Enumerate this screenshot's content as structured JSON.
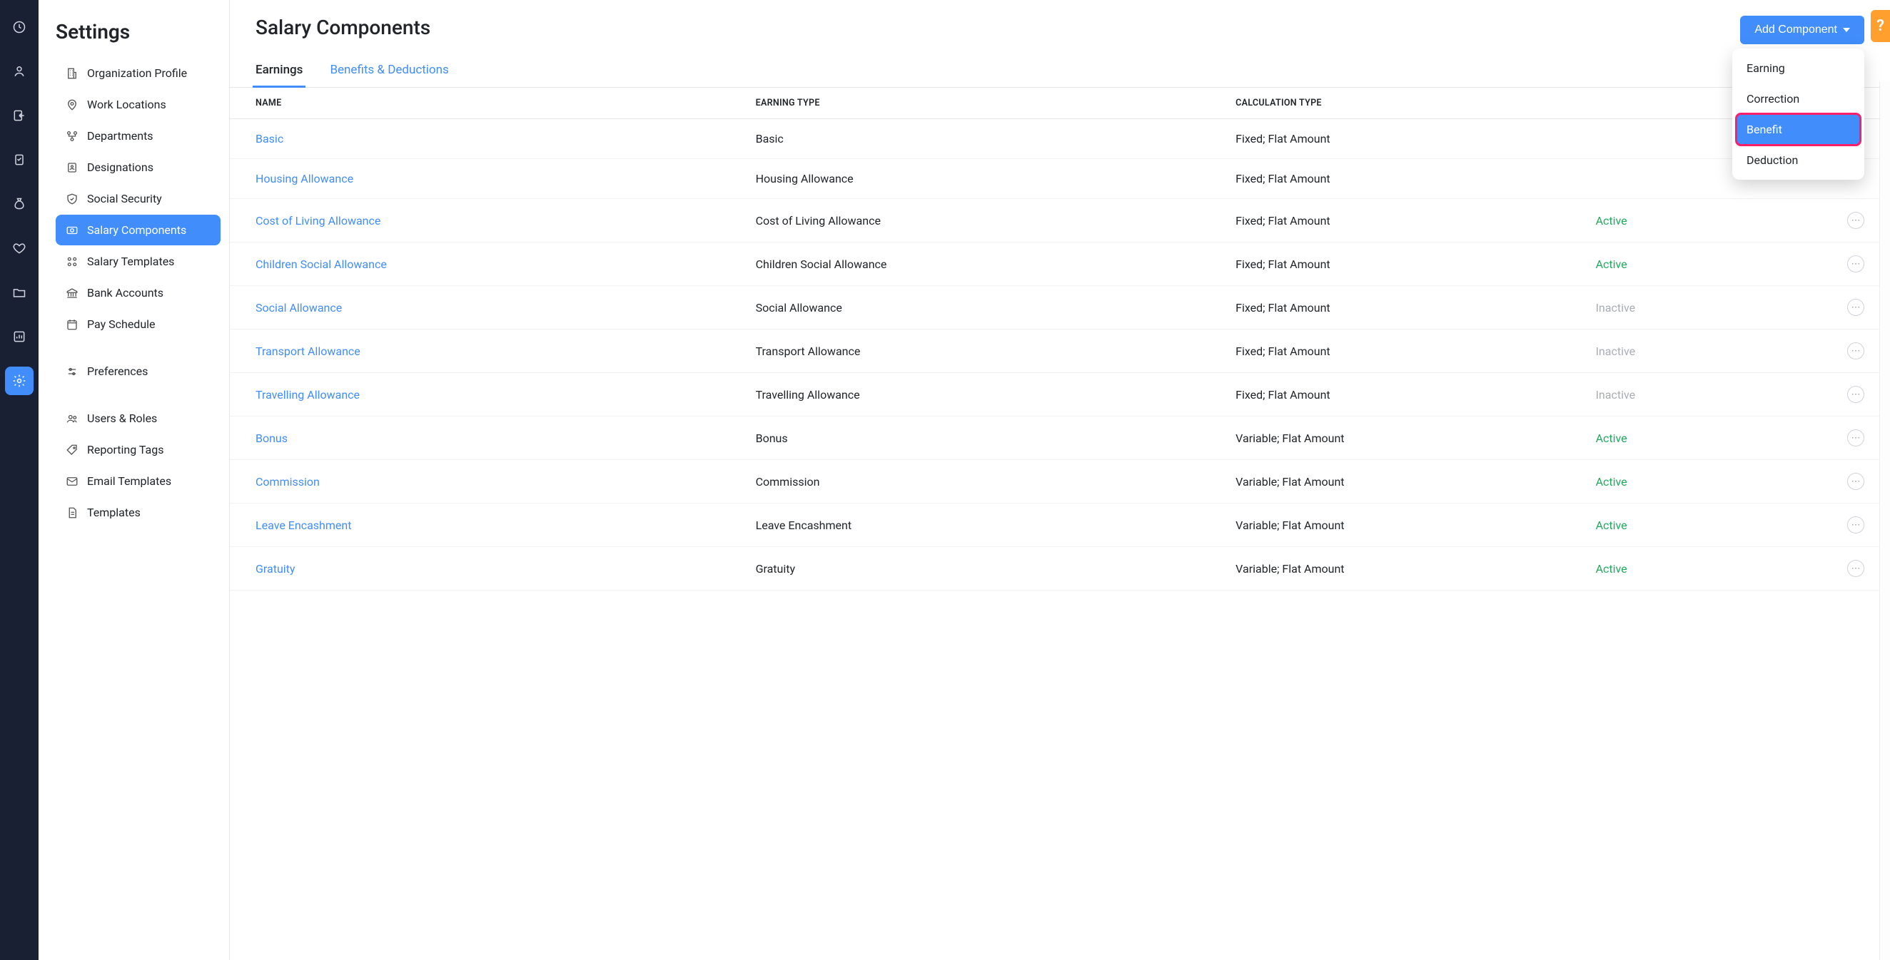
{
  "rail": [
    {
      "name": "dashboard-icon"
    },
    {
      "name": "person-icon"
    },
    {
      "name": "exit-icon"
    },
    {
      "name": "clipboard-icon"
    },
    {
      "name": "money-bag-icon"
    },
    {
      "name": "heart-icon"
    },
    {
      "name": "folder-icon"
    },
    {
      "name": "report-icon"
    },
    {
      "name": "settings-icon",
      "active": true
    }
  ],
  "settings": {
    "title": "Settings",
    "items": [
      {
        "icon": "building-icon",
        "label": "Organization Profile"
      },
      {
        "icon": "location-pin-icon",
        "label": "Work Locations"
      },
      {
        "icon": "org-chart-icon",
        "label": "Departments"
      },
      {
        "icon": "id-badge-icon",
        "label": "Designations"
      },
      {
        "icon": "shield-icon",
        "label": "Social Security"
      },
      {
        "icon": "salary-components-icon",
        "label": "Salary Components",
        "active": true
      },
      {
        "icon": "salary-templates-icon",
        "label": "Salary Templates"
      },
      {
        "icon": "bank-icon",
        "label": "Bank Accounts"
      },
      {
        "icon": "calendar-icon",
        "label": "Pay Schedule"
      },
      {
        "gap": true
      },
      {
        "icon": "sliders-icon",
        "label": "Preferences"
      },
      {
        "gap": true
      },
      {
        "icon": "users-icon",
        "label": "Users & Roles"
      },
      {
        "icon": "tag-icon",
        "label": "Reporting Tags"
      },
      {
        "icon": "envelope-icon",
        "label": "Email Templates"
      },
      {
        "icon": "file-icon",
        "label": "Templates"
      }
    ]
  },
  "page": {
    "title": "Salary Components",
    "addButton": "Add Component",
    "help": "?"
  },
  "tabs": [
    {
      "label": "Earnings",
      "active": true
    },
    {
      "label": "Benefits & Deductions"
    }
  ],
  "columns": {
    "name": "NAME",
    "type": "EARNING TYPE",
    "calc": "CALCULATION TYPE"
  },
  "rows": [
    {
      "name": "Basic",
      "type": "Basic",
      "calc": "Fixed; Flat Amount",
      "status": ""
    },
    {
      "name": "Housing Allowance",
      "type": "Housing Allowance",
      "calc": "Fixed; Flat Amount",
      "status": ""
    },
    {
      "name": "Cost of Living Allowance",
      "type": "Cost of Living Allowance",
      "calc": "Fixed; Flat Amount",
      "status": "Active"
    },
    {
      "name": "Children Social Allowance",
      "type": "Children Social Allowance",
      "calc": "Fixed; Flat Amount",
      "status": "Active"
    },
    {
      "name": "Social Allowance",
      "type": "Social Allowance",
      "calc": "Fixed; Flat Amount",
      "status": "Inactive"
    },
    {
      "name": "Transport Allowance",
      "type": "Transport Allowance",
      "calc": "Fixed; Flat Amount",
      "status": "Inactive"
    },
    {
      "name": "Travelling Allowance",
      "type": "Travelling Allowance",
      "calc": "Fixed; Flat Amount",
      "status": "Inactive"
    },
    {
      "name": "Bonus",
      "type": "Bonus",
      "calc": "Variable; Flat Amount",
      "status": "Active"
    },
    {
      "name": "Commission",
      "type": "Commission",
      "calc": "Variable; Flat Amount",
      "status": "Active"
    },
    {
      "name": "Leave Encashment",
      "type": "Leave Encashment",
      "calc": "Variable; Flat Amount",
      "status": "Active"
    },
    {
      "name": "Gratuity",
      "type": "Gratuity",
      "calc": "Variable; Flat Amount",
      "status": "Active"
    }
  ],
  "dropdown": [
    {
      "label": "Earning"
    },
    {
      "label": "Correction"
    },
    {
      "label": "Benefit",
      "highlight": true
    },
    {
      "label": "Deduction"
    }
  ]
}
